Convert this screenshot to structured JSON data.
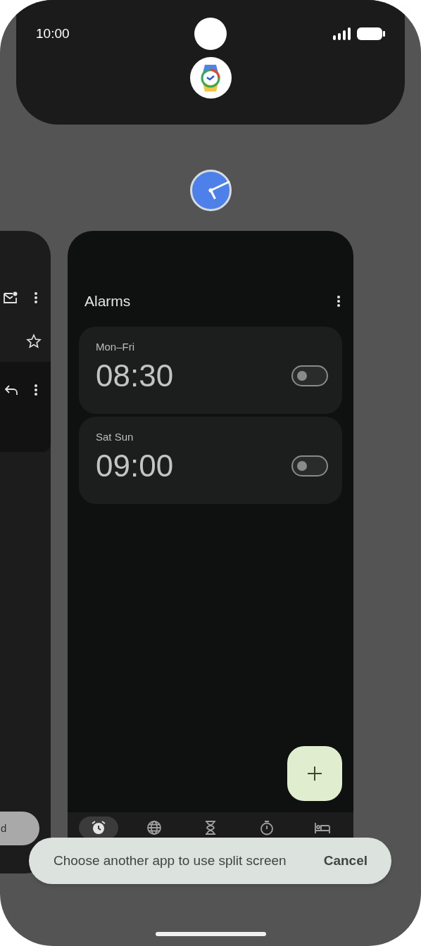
{
  "status_bar": {
    "time": "10:00"
  },
  "left_card": {
    "button_label": "d"
  },
  "clock_card": {
    "title": "Alarms",
    "alarms": [
      {
        "days": "Mon–Fri",
        "time": "08:30",
        "on": false
      },
      {
        "days": "Sat Sun",
        "time": "09:00",
        "on": false
      }
    ],
    "nav_tabs": [
      {
        "kind": "alarm",
        "selected": true
      },
      {
        "kind": "world",
        "selected": false
      },
      {
        "kind": "timer",
        "selected": false
      },
      {
        "kind": "stopwatch",
        "selected": false
      },
      {
        "kind": "bedtime",
        "selected": false
      }
    ]
  },
  "snackbar": {
    "message": "Choose another app to use split screen",
    "action": "Cancel"
  }
}
